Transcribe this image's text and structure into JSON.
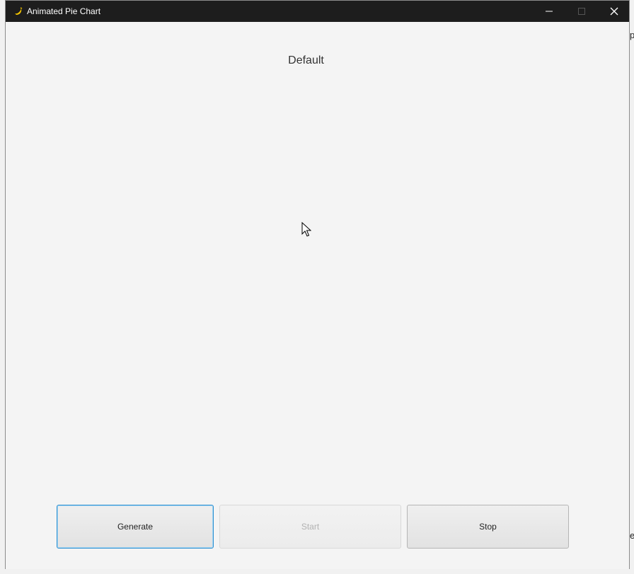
{
  "window": {
    "title": "Animated Pie Chart",
    "app_icon": "app-icon",
    "controls": {
      "minimize_icon": "minimize-icon",
      "maximize_icon": "maximize-icon",
      "close_icon": "close-icon"
    }
  },
  "chart": {
    "title": "Default"
  },
  "buttons": {
    "generate": "Generate",
    "start": "Start",
    "stop": "Stop"
  },
  "background_edge_text": [
    "p",
    "e"
  ],
  "colors": {
    "titlebar": "#1d1d1d",
    "focus_border": "#2b8fd0",
    "disabled_text": "#b2b2b2"
  }
}
